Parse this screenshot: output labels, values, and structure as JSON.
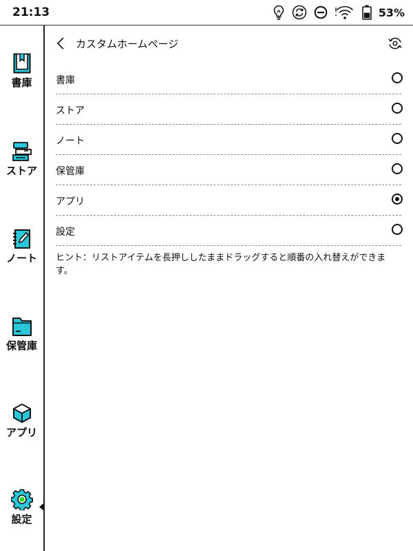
{
  "status_bar": {
    "time": "21:13",
    "battery": "53%",
    "icons": [
      "lightbulb-icon",
      "sync-icon",
      "do-not-disturb-icon",
      "wifi-icon",
      "battery-icon"
    ]
  },
  "sidebar": {
    "items": [
      {
        "label": "書庫",
        "icon": "bookshelf-icon",
        "active": false
      },
      {
        "label": "ストア",
        "icon": "store-icon",
        "active": false
      },
      {
        "label": "ノート",
        "icon": "note-icon",
        "active": false
      },
      {
        "label": "保管庫",
        "icon": "folder-icon",
        "active": false
      },
      {
        "label": "アプリ",
        "icon": "apps-cube-icon",
        "active": false
      },
      {
        "label": "設定",
        "icon": "gear-icon",
        "active": true
      }
    ],
    "accent_color": "#29c7d9",
    "active_dot_color": "#22dd22"
  },
  "header": {
    "title": "カスタムホームページ",
    "back_icon": "chevron-left-icon",
    "reset_icon": "reset-icon"
  },
  "options": [
    {
      "label": "書庫",
      "selected": false
    },
    {
      "label": "ストア",
      "selected": false
    },
    {
      "label": "ノート",
      "selected": false
    },
    {
      "label": "保管庫",
      "selected": false
    },
    {
      "label": "アプリ",
      "selected": true
    },
    {
      "label": "設定",
      "selected": false
    }
  ],
  "hint": "ヒント：リストアイテムを長押ししたままドラッグすると順番の入れ替えができます。"
}
